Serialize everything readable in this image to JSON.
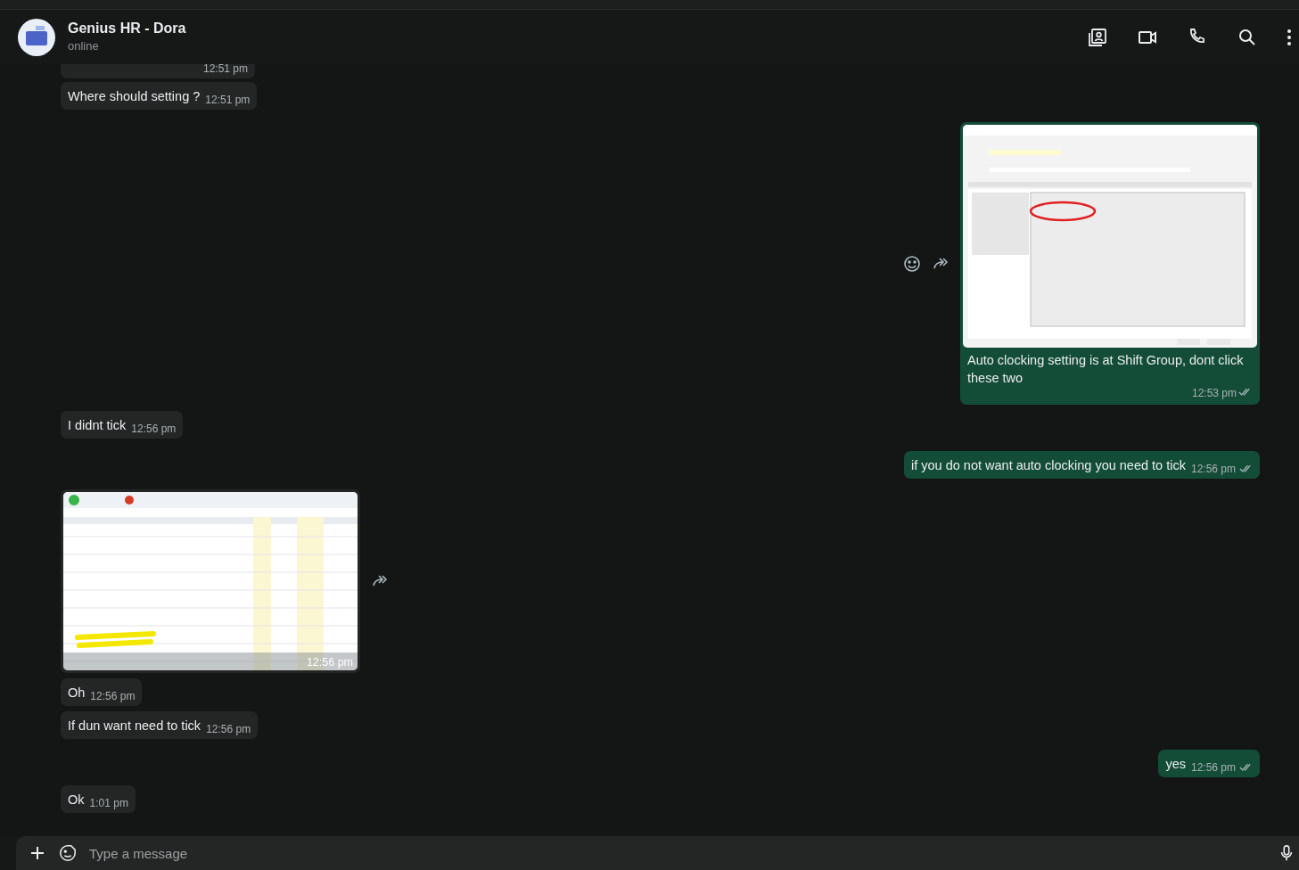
{
  "header": {
    "title": "Genius HR - Dora",
    "status": "online"
  },
  "messages": [
    {
      "outgoing": false,
      "kind": "text",
      "time": "12:51 pm"
    },
    {
      "outgoing": false,
      "kind": "text",
      "text": "Where should setting ?",
      "time": "12:51 pm"
    },
    {
      "outgoing": true,
      "kind": "picture",
      "caption": "Auto clocking setting is at Shift Group, dont click these two",
      "time": "12:53 pm"
    },
    {
      "outgoing": false,
      "kind": "text",
      "text": "I didnt tick",
      "time": "12:56 pm"
    },
    {
      "outgoing": true,
      "kind": "text",
      "text": "if you do not want auto clocking you need to tick",
      "time": "12:56 pm"
    },
    {
      "outgoing": false,
      "kind": "picture",
      "time": "12:56 pm"
    },
    {
      "outgoing": false,
      "kind": "text",
      "text": "Oh",
      "time": "12:56 pm"
    },
    {
      "outgoing": false,
      "kind": "text",
      "text": "If dun want need to tick",
      "time": "12:56 pm"
    },
    {
      "outgoing": true,
      "kind": "text",
      "text": "yes",
      "time": "12:56 pm"
    },
    {
      "outgoing": false,
      "kind": "text",
      "text": "Ok",
      "time": "1:01 pm"
    }
  ],
  "composer": {
    "placeholder": "Type a message"
  }
}
